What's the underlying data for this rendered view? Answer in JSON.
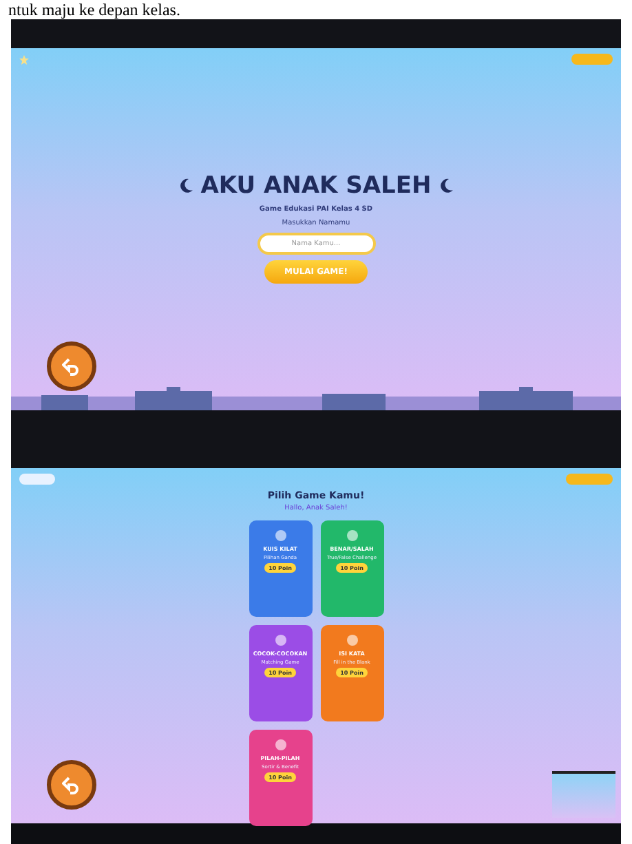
{
  "document_text": "ntuk maju ke depan kelas.",
  "start_screen": {
    "title": "AKU ANAK SALEH",
    "subtitle": "Game Edukasi PAI Kelas 4 SD",
    "name_label": "Masukkan Namamu",
    "name_field": {
      "placeholder": "Nama Kamu..."
    },
    "start_button": "MULAI GAME!"
  },
  "menu_screen": {
    "title": "Pilih Game Kamu!",
    "greeting": "Hallo, Anak Saleh!",
    "games": [
      {
        "name": "KUIS KILAT",
        "subtitle": "Pilihan Ganda",
        "points": "10 Poin",
        "color": "#3b7be8"
      },
      {
        "name": "BENAR/SALAH",
        "subtitle": "True/False Challenge",
        "points": "10 Poin",
        "color": "#22b86a"
      },
      {
        "name": "COCOK-COCOKAN",
        "subtitle": "Matching Game",
        "points": "10 Poin",
        "color": "#9b4de6"
      },
      {
        "name": "ISI KATA",
        "subtitle": "Fill in the Blank",
        "points": "10 Poin",
        "color": "#f27a1e"
      },
      {
        "name": "PILAH-PILAH",
        "subtitle": "Sortir & Benefit",
        "points": "10 Poin",
        "color": "#e6428c"
      }
    ]
  }
}
